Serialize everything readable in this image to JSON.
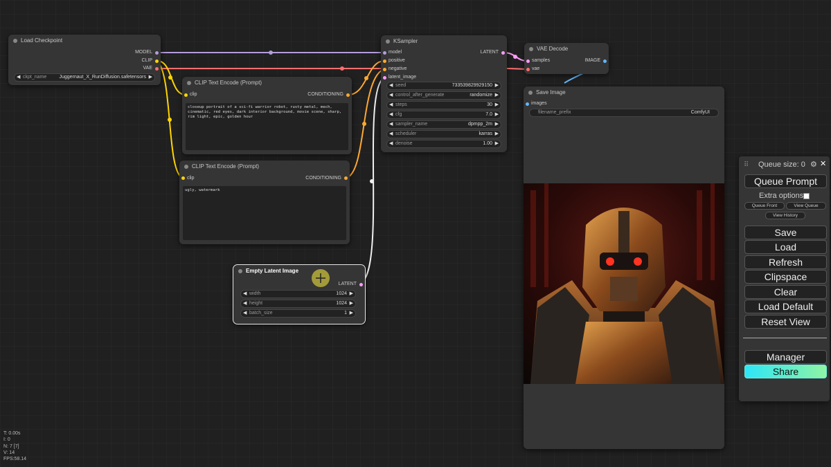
{
  "nodes": {
    "load_checkpoint": {
      "title": "Load Checkpoint",
      "outputs": [
        "MODEL",
        "CLIP",
        "VAE"
      ],
      "ckpt_name_label": "ckpt_name",
      "ckpt_name_value": "Juggernaut_X_RunDiffusion.safetensors"
    },
    "clip_pos": {
      "title": "CLIP Text Encode (Prompt)",
      "input": "clip",
      "output": "CONDITIONING",
      "text": "closeup portrait of a sci-fi warrior robot, rusty metal, mech, cinematic, red eyes, dark interior background, movie scene, sharp, rim light, epic, golden hour"
    },
    "clip_neg": {
      "title": "CLIP Text Encode (Prompt)",
      "input": "clip",
      "output": "CONDITIONING",
      "text": "ugly, watermark"
    },
    "ksampler": {
      "title": "KSampler",
      "inputs": [
        "model",
        "positive",
        "negative",
        "latent_image"
      ],
      "output": "LATENT",
      "widgets": [
        {
          "label": "seed",
          "value": "733539829929150"
        },
        {
          "label": "control_after_generate",
          "value": "randomize"
        },
        {
          "label": "steps",
          "value": "30"
        },
        {
          "label": "cfg",
          "value": "7.0"
        },
        {
          "label": "sampler_name",
          "value": "dpmpp_2m"
        },
        {
          "label": "scheduler",
          "value": "karras"
        },
        {
          "label": "denoise",
          "value": "1.00"
        }
      ]
    },
    "vae_decode": {
      "title": "VAE Decode",
      "inputs": [
        "samples",
        "vae"
      ],
      "output": "IMAGE"
    },
    "save_image": {
      "title": "Save Image",
      "input": "images",
      "prefix_label": "filename_prefix",
      "prefix_value": "ComfyUI"
    },
    "empty_latent": {
      "title": "Empty Latent Image",
      "output": "LATENT",
      "widgets": [
        {
          "label": "width",
          "value": "1024"
        },
        {
          "label": "height",
          "value": "1024"
        },
        {
          "label": "batch_size",
          "value": "1"
        }
      ]
    }
  },
  "panel": {
    "queue_size": "Queue size: 0",
    "queue_prompt": "Queue Prompt",
    "extra_options": "Extra options",
    "queue_front": "Queue Front",
    "view_queue": "View Queue",
    "view_history": "View History",
    "save": "Save",
    "load": "Load",
    "refresh": "Refresh",
    "clipspace": "Clipspace",
    "clear": "Clear",
    "load_default": "Load Default",
    "reset_view": "Reset View",
    "manager": "Manager",
    "share": "Share"
  },
  "stats": {
    "t": "T: 0.00s",
    "i": "I: 0",
    "n": "N: 7 [7]",
    "v": "V: 14",
    "fps": "FPS:58.14"
  },
  "colors": {
    "model": "#b39ddb",
    "clip": "#ffd500",
    "vae": "#ff6e6e",
    "conditioning": "#ffa931",
    "latent": "#ff9cf9",
    "image": "#64b5f6",
    "share_gradient": [
      "#2ee6f7",
      "#8ef5a4"
    ]
  }
}
